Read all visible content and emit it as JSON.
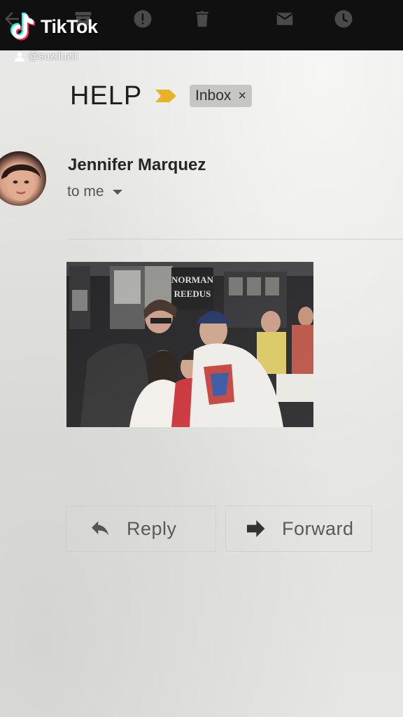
{
  "tiktok": {
    "brand": "TikTok",
    "username": "@suzduzit"
  },
  "toolbar": {
    "icons": [
      "back-arrow-icon",
      "archive-icon",
      "report-spam-icon",
      "delete-icon",
      "mark-unread-icon",
      "snooze-icon"
    ]
  },
  "email": {
    "subject": "HELP",
    "label": "Inbox",
    "label_close": "×",
    "sender": "Jennifer Marquez",
    "recipient": "to me",
    "photo_banner_text": "NORMAN REEDUS"
  },
  "actions": {
    "reply": "Reply",
    "forward": "Forward"
  },
  "colors": {
    "toolbar_bg": "#101010",
    "important_marker": "#e8b228",
    "label_bg": "#c6c6c4"
  }
}
